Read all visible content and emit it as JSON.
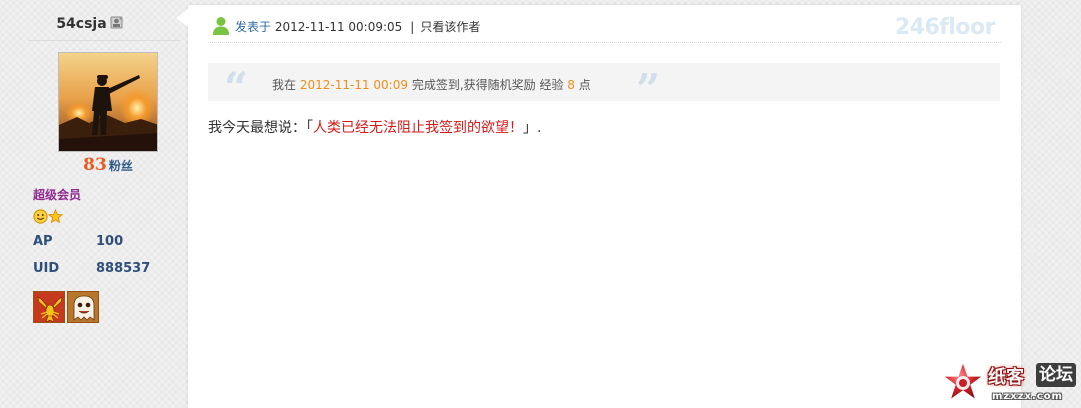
{
  "user": {
    "name": "54csja",
    "fans_count": "83",
    "fans_label": "粉丝",
    "group": "超级会员",
    "badges": [
      "smiley-icon",
      "star-icon"
    ],
    "stats": {
      "ap_label": "AP",
      "ap_value": "100",
      "uid_label": "UID",
      "uid_value": "888537"
    },
    "medals": [
      "scorpion-medal-icon",
      "ghost-medal-icon"
    ]
  },
  "post": {
    "posted_label": "发表于",
    "posted_time": "2012-11-11 00:09:05",
    "separator": "|",
    "author_only_link": "只看该作者",
    "floor": "246floor",
    "checkin": {
      "prefix": "我在",
      "time": "2012-11-11 00:09",
      "middle": "完成签到,获得随机奖励 经验",
      "points": "8",
      "suffix": "点"
    },
    "message": {
      "prefix": "我今天最想说：「",
      "highlight": "人类已经无法阻止我签到的欲望！",
      "suffix": "」."
    }
  },
  "watermark": {
    "brand_part1": "纸客",
    "brand_part2": "论坛",
    "site": "mzxzx.com"
  },
  "colors": {
    "accent_orange": "#e85b21",
    "checkin_highlight": "#f18d1a",
    "message_red": "#d41a1a",
    "stat_blue": "#2f4f7a",
    "group_purple": "#8e2a8e"
  }
}
